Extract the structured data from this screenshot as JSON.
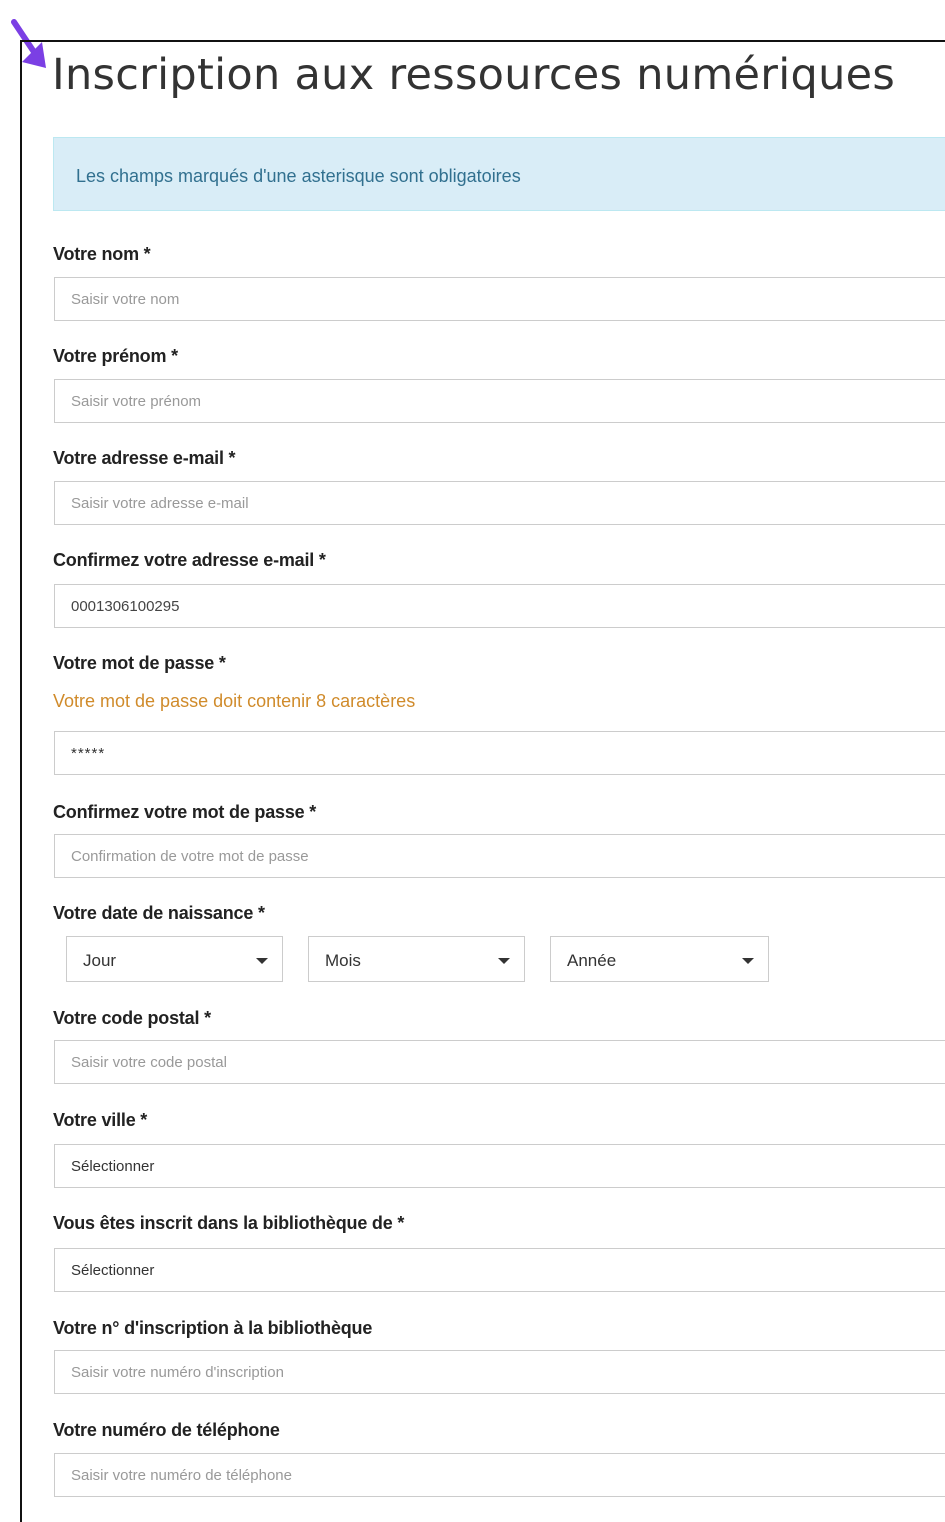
{
  "colors": {
    "accent_arrow": "#7b3fe4",
    "info_bg": "#d9edf7",
    "hint": "#d08b2b"
  },
  "page_title": "Inscription aux ressources numériques",
  "info_message": "Les champs marqués d'une asterisque sont obligatoires",
  "fields": {
    "nom": {
      "label": "Votre nom *",
      "placeholder": "Saisir votre nom"
    },
    "prenom": {
      "label": "Votre prénom *",
      "placeholder": "Saisir votre prénom"
    },
    "email": {
      "label": "Votre adresse e-mail *",
      "placeholder": "Saisir votre adresse e-mail"
    },
    "email_confirm": {
      "label": "Confirmez votre adresse e-mail *",
      "value": "0001306100295"
    },
    "password": {
      "label": "Votre mot de passe *",
      "hint": "Votre mot de passe doit contenir 8 caractères",
      "value": "*****"
    },
    "password_confirm": {
      "label": "Confirmez votre mot de passe *",
      "placeholder": "Confirmation de votre mot de passe"
    },
    "birthdate": {
      "label": "Votre date de naissance *",
      "day": "Jour",
      "month": "Mois",
      "year": "Année"
    },
    "postal": {
      "label": "Votre code postal *",
      "placeholder": "Saisir votre code postal"
    },
    "city": {
      "label": "Votre ville *",
      "selected": "Sélectionner"
    },
    "library": {
      "label": "Vous êtes inscrit dans la bibliothèque de *",
      "selected": "Sélectionner"
    },
    "library_number": {
      "label": "Votre n° d'inscription à la bibliothèque",
      "placeholder": "Saisir votre numéro d'inscription"
    },
    "phone": {
      "label": "Votre numéro de téléphone",
      "placeholder": "Saisir votre numéro de téléphone"
    }
  }
}
